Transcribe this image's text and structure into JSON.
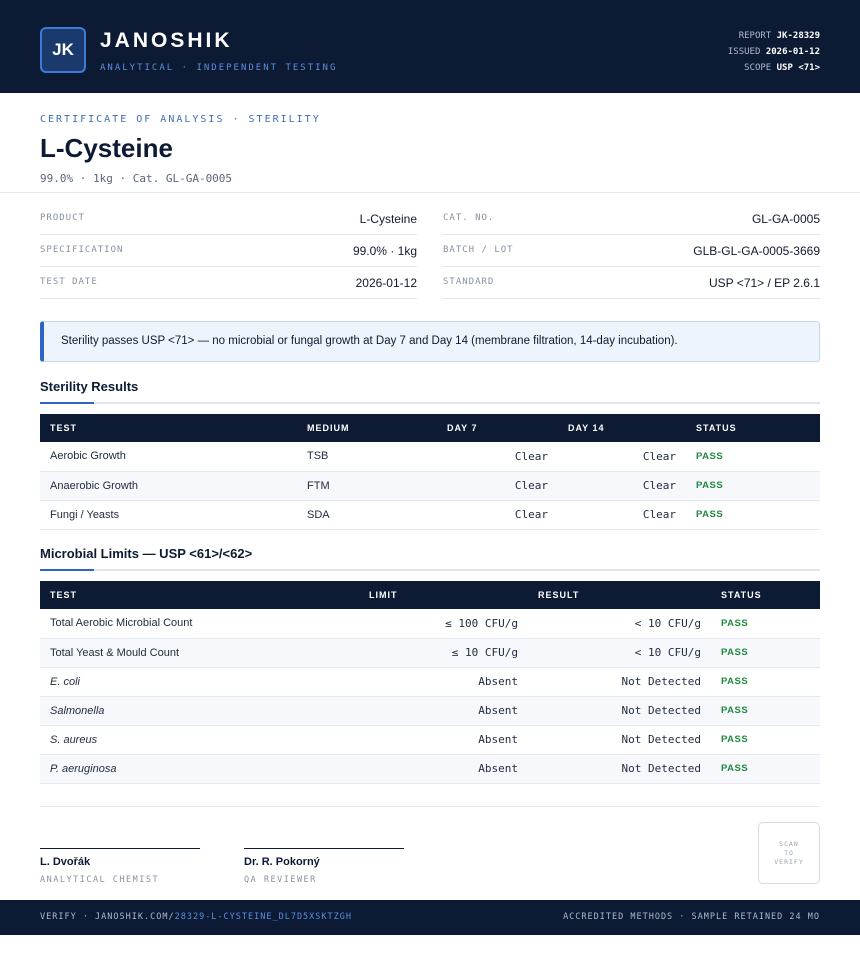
{
  "header": {
    "logo_initials": "JK",
    "brand": "JANOSHIK",
    "tagline": "ANALYTICAL · INDEPENDENT TESTING",
    "report_label": "REPORT",
    "report_value": "JK-28329",
    "issued_label": "ISSUED",
    "issued_value": "2026-01-12",
    "scope_label": "SCOPE",
    "scope_value": "USP <71>"
  },
  "document": {
    "kicker": "CERTIFICATE OF ANALYSIS · STERILITY",
    "title": "L-Cysteine",
    "subtitle": "99.0% · 1kg  ·  Cat. GL-GA-0005"
  },
  "info": {
    "product_label": "PRODUCT",
    "product_value": "L-Cysteine",
    "spec_label": "SPECIFICATION",
    "spec_value": "99.0% · 1kg",
    "date_label": "TEST DATE",
    "date_value": "2026-01-12",
    "cat_label": "CAT. NO.",
    "cat_value": "GL-GA-0005",
    "batch_label": "BATCH / LOT",
    "batch_value": "GLB-GL-GA-0005-3669",
    "standard_label": "STANDARD",
    "standard_value": "USP <71> / EP 2.6.1"
  },
  "callout": "Sterility passes USP <71> — no microbial or fungal growth at Day 7 and Day 14 (membrane filtration, 14-day incubation).",
  "sterility": {
    "title": "Sterility Results",
    "headers": [
      "TEST",
      "MEDIUM",
      "DAY 7",
      "DAY 14",
      "STATUS"
    ],
    "rows": [
      [
        "Aerobic Growth",
        "TSB",
        "Clear",
        "Clear",
        "PASS"
      ],
      [
        "Anaerobic Growth",
        "FTM",
        "Clear",
        "Clear",
        "PASS"
      ],
      [
        "Fungi / Yeasts",
        "SDA",
        "Clear",
        "Clear",
        "PASS"
      ]
    ]
  },
  "microbial": {
    "title": "Microbial Limits — USP <61>/<62>",
    "headers": [
      "TEST",
      "LIMIT",
      "RESULT",
      "STATUS"
    ],
    "rows": [
      [
        "Total Aerobic Microbial Count",
        "≤ 100 CFU/g",
        "< 10 CFU/g",
        "PASS"
      ],
      [
        "Total Yeast & Mould Count",
        "≤ 10 CFU/g",
        "< 10 CFU/g",
        "PASS"
      ],
      [
        "E. coli",
        "Absent",
        "Not Detected",
        "PASS"
      ],
      [
        "Salmonella",
        "Absent",
        "Not Detected",
        "PASS"
      ],
      [
        "S. aureus",
        "Absent",
        "Not Detected",
        "PASS"
      ],
      [
        "P. aeruginosa",
        "Absent",
        "Not Detected",
        "PASS"
      ]
    ]
  },
  "signatures": {
    "sig1_name": "L. Dvořák",
    "sig1_role": "ANALYTICAL CHEMIST",
    "sig2_name": "Dr. R. Pokorný",
    "sig2_role": "QA REVIEWER",
    "qr_line1": "SCAN",
    "qr_line2": "TO",
    "qr_line3": "VERIFY"
  },
  "footer": {
    "verify_prefix": "VERIFY · JANOSHIK.COM/",
    "verify_code": "28329-L-CYSTEINE_DL7D5XSKTZGH",
    "right": "ACCREDITED METHODS · SAMPLE RETAINED 24 MO"
  }
}
